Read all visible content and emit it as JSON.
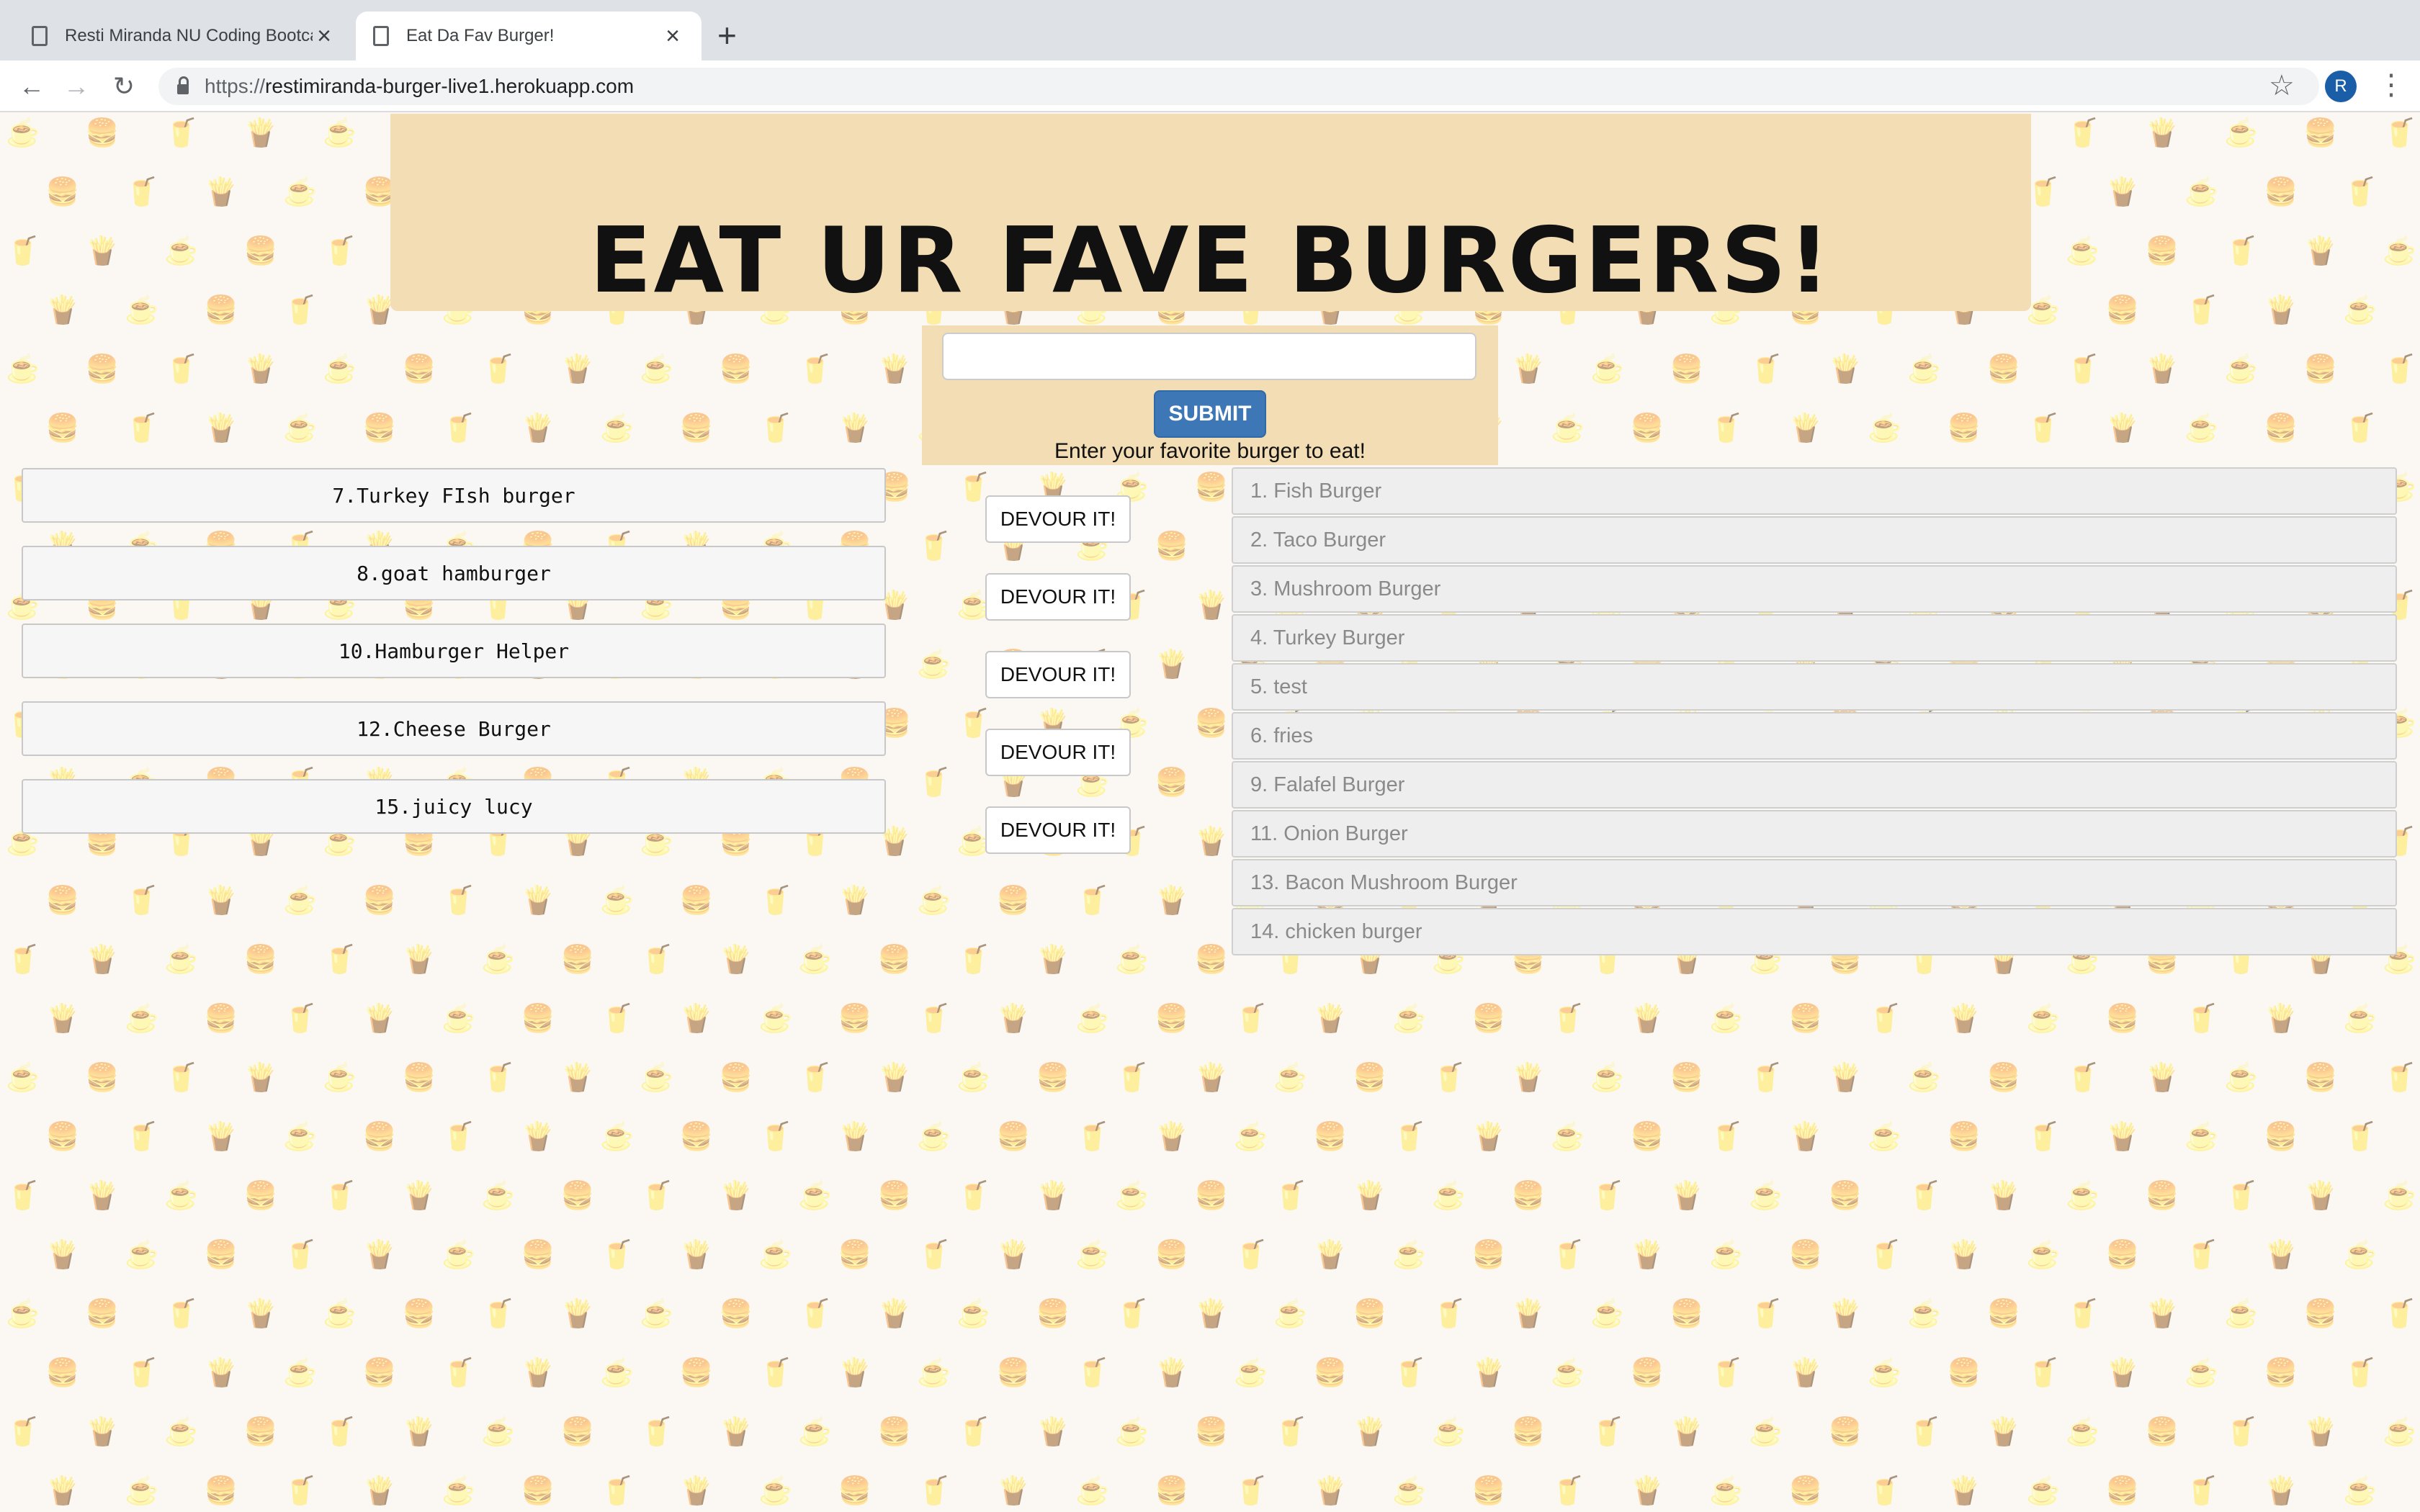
{
  "browser": {
    "tabs": [
      {
        "title": "Resti Miranda NU Coding Bootcamp",
        "active": false
      },
      {
        "title": "Eat Da Fav Burger!",
        "active": true
      }
    ],
    "url_prefix": "https://",
    "url_host": "restimiranda-burger-live1.herokuapp.com",
    "profile_initial": "R"
  },
  "page": {
    "title": "EAT UR FAVE BURGERS!",
    "form": {
      "input_value": "",
      "submit_label": "SUBMIT",
      "instruction": "Enter your favorite burger to eat!"
    },
    "uneaten": [
      {
        "label": "7.Turkey FIsh burger",
        "button": "DEVOUR IT!"
      },
      {
        "label": "8.goat hamburger",
        "button": "DEVOUR IT!"
      },
      {
        "label": "10.Hamburger Helper",
        "button": "DEVOUR IT!"
      },
      {
        "label": "12.Cheese Burger",
        "button": "DEVOUR IT!"
      },
      {
        "label": "15.juicy lucy",
        "button": "DEVOUR IT!"
      }
    ],
    "eaten": [
      "1. Fish Burger",
      "2. Taco Burger",
      "3. Mushroom Burger",
      "4. Turkey Burger",
      "5. test",
      "6. fries",
      "9. Falafel Burger",
      "11. Onion Burger",
      "13. Bacon Mushroom Burger",
      "14. chicken burger"
    ]
  },
  "colors": {
    "header_bg": "#f3ddb5",
    "submit_bg": "#3d77b6",
    "pattern_icon": "#f3c98a"
  }
}
